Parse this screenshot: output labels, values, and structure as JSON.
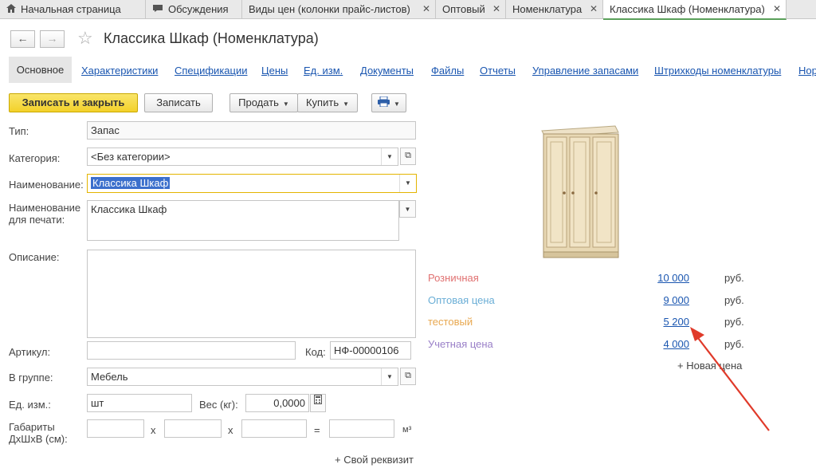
{
  "tabs": [
    {
      "label": "Начальная страница",
      "icon": "home-icon"
    },
    {
      "label": "Обсуждения",
      "icon": "chat-icon"
    },
    {
      "label": "Виды цен (колонки прайс-листов)",
      "close": "✕"
    },
    {
      "label": "Оптовый",
      "close": "✕"
    },
    {
      "label": "Номенклатура",
      "close": "✕"
    },
    {
      "label": "Классика Шкаф (Номенклатура)",
      "close": "✕"
    }
  ],
  "header": {
    "back": "←",
    "forward": "→",
    "star": "☆",
    "title": "Классика Шкаф (Номенклатура)"
  },
  "sections": [
    "Основное",
    "Характеристики",
    "Спецификации",
    "Цены",
    "Ед. изм.",
    "Документы",
    "Файлы",
    "Отчеты",
    "Управление запасами",
    "Штрихкоды номенклатуры",
    "Нор"
  ],
  "toolbar": {
    "save_close": "Записать и закрыть",
    "save": "Записать",
    "sell": "Продать",
    "buy": "Купить",
    "print_icon": "printer-icon"
  },
  "form": {
    "type_label": "Тип:",
    "type_value": "Запас",
    "category_label": "Категория:",
    "category_value": "<Без категории>",
    "name_label": "Наименование:",
    "name_value": "Классика Шкаф",
    "print_name_label_1": "Наименование",
    "print_name_label_2": "для печати:",
    "print_name_value": "Классика Шкаф",
    "description_label": "Описание:",
    "description_value": "",
    "article_label": "Артикул:",
    "article_value": "",
    "code_label": "Код:",
    "code_value": "НФ-00000106",
    "group_label": "В группе:",
    "group_value": "Мебель",
    "unit_label": "Ед. изм.:",
    "unit_value": "шт",
    "weight_label": "Вес (кг):",
    "weight_value": "0,0000",
    "dims_label_1": "Габариты",
    "dims_label_2": "ДхШхВ (см):",
    "dims_sep_x": "x",
    "dims_eq": "=",
    "dims_unit": "м³",
    "own_prop": "+ Свой реквизит"
  },
  "prices": [
    {
      "name": "Розничная",
      "value": "10 000",
      "currency": "руб.",
      "color": "#e07070"
    },
    {
      "name": "Оптовая цена",
      "value": "9 000",
      "currency": "руб.",
      "color": "#6aaed6"
    },
    {
      "name": "тестовый",
      "value": "5 200",
      "currency": "руб.",
      "color": "#e8a850"
    },
    {
      "name": "Учетная цена",
      "value": "4 000",
      "currency": "руб.",
      "color": "#9a80c8"
    }
  ],
  "new_price": "+ Новая цена",
  "colors": {
    "accent": "#f3d12a",
    "link": "#1a56b0",
    "annotation_arrow": "#e03a2a"
  }
}
